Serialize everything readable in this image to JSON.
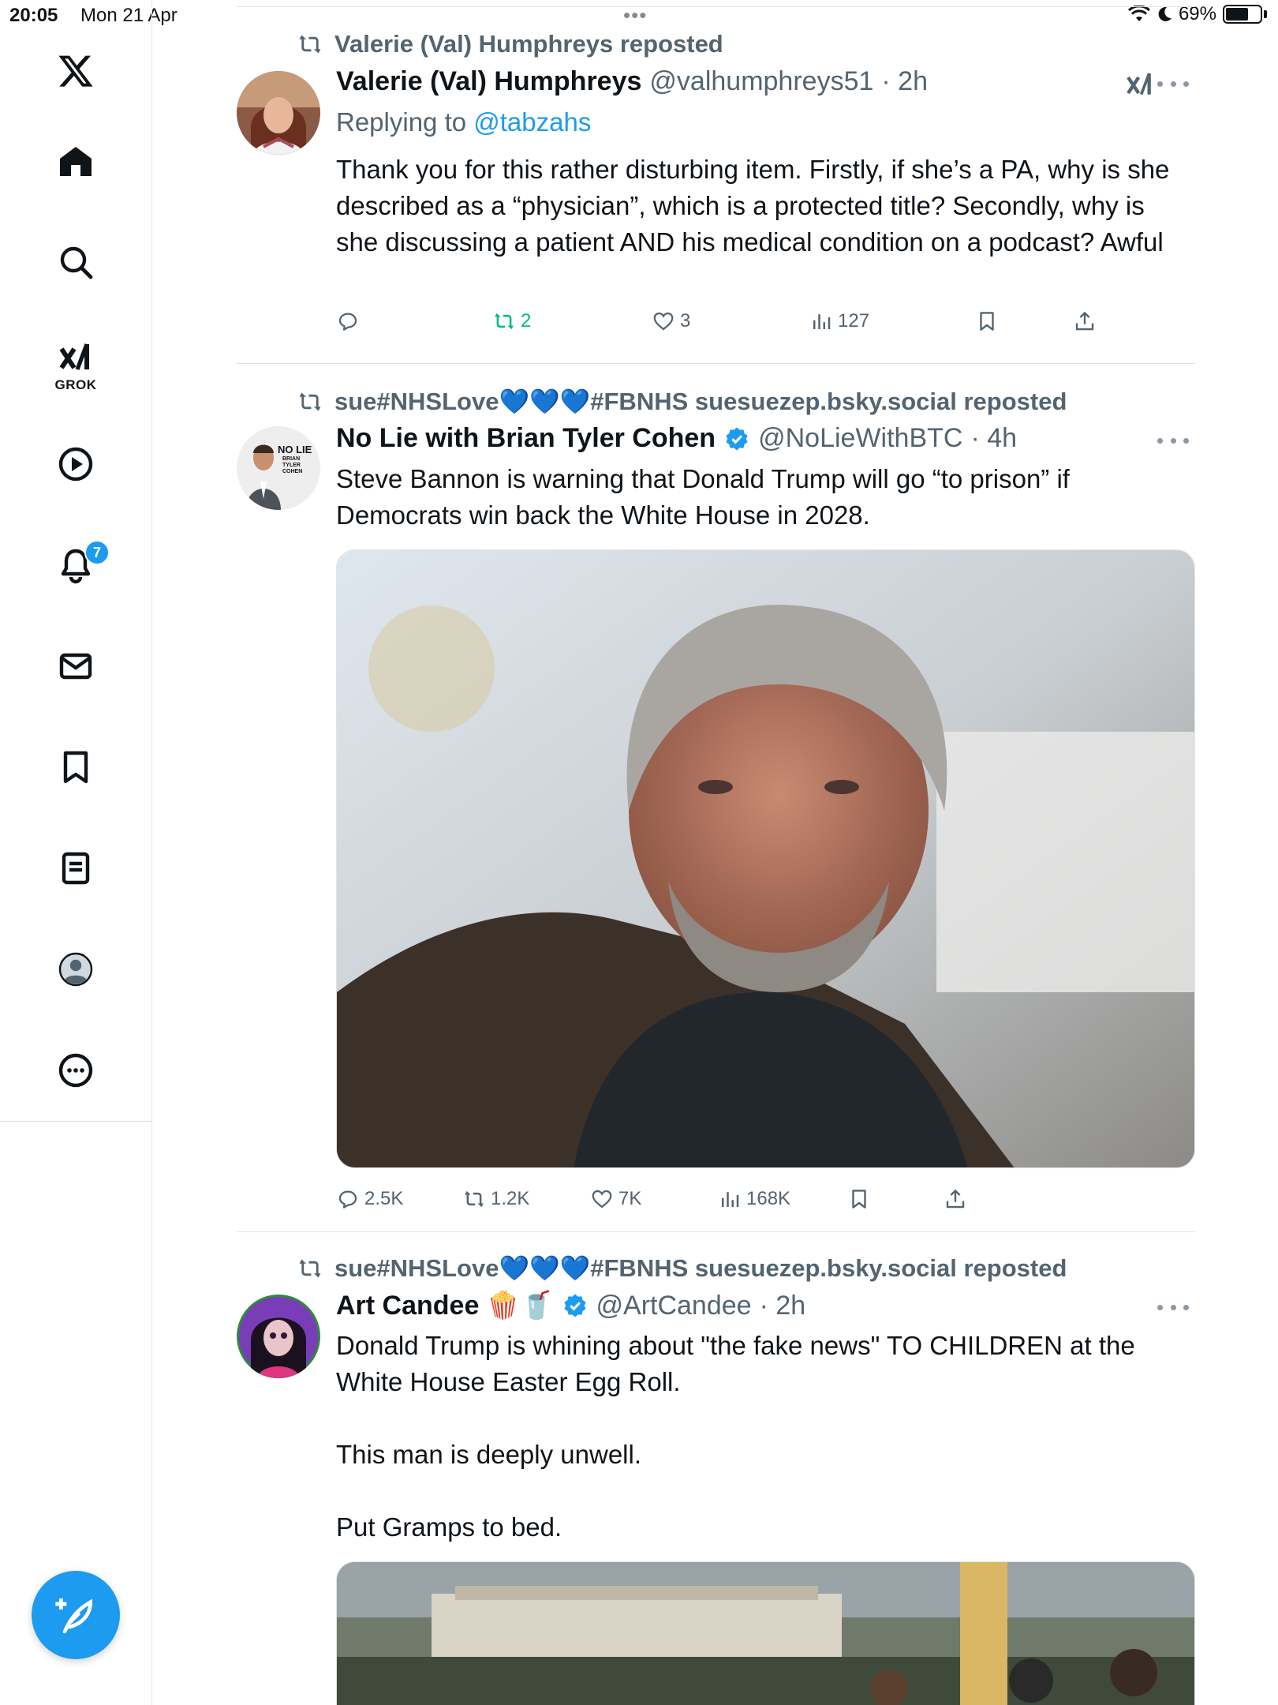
{
  "status_bar": {
    "time": "20:05",
    "date": "Mon 21 Apr",
    "dots": "•••",
    "battery": "69%",
    "battery_level": 0.69
  },
  "sidebar": {
    "items": [
      {
        "name": "logo",
        "icon": "x-logo-icon"
      },
      {
        "name": "home",
        "icon": "home-icon"
      },
      {
        "name": "search",
        "icon": "search-icon"
      },
      {
        "name": "grok",
        "icon": "grok-icon",
        "label": "GROK"
      },
      {
        "name": "video",
        "icon": "play-icon"
      },
      {
        "name": "notifications",
        "icon": "bell-icon",
        "badge": "7"
      },
      {
        "name": "messages",
        "icon": "envelope-icon"
      },
      {
        "name": "bookmarks",
        "icon": "bookmark-icon"
      },
      {
        "name": "lists",
        "icon": "list-icon"
      },
      {
        "name": "profile",
        "icon": "profile-icon"
      },
      {
        "name": "more",
        "icon": "more-circle-icon"
      }
    ],
    "compose_icon": "compose-feather-icon"
  },
  "posts": [
    {
      "reposted_by": "Valerie (Val) Humphreys reposted",
      "display_name": "Valerie (Val) Humphreys",
      "handle": "@valhumphreys51",
      "time": "· 2h",
      "replying_prefix": "Replying to ",
      "replying_to": "@tabzahs",
      "text": "Thank you for this rather disturbing item. Firstly, if she’s a PA, why is she described as a “physician”, which is a protected title? Secondly, why is she discussing a patient AND his medical condition on a podcast? Awful",
      "replies": "",
      "reposts": "2",
      "likes": "3",
      "views": "127"
    },
    {
      "reposted_by": "sue#NHSLove💙💙💙#FBNHS suesuezep.bsky.social reposted",
      "display_name": "No Lie with Brian Tyler Cohen",
      "handle": "@NoLieWithBTC",
      "time": "· 4h",
      "avatar_text_1": "NO LIE",
      "avatar_text_2": "BRIAN TYLER COHEN",
      "text": "Steve Bannon is warning that Donald Trump will go “to prison” if Democrats win back the White House in 2028.",
      "replies": "2.5K",
      "reposts": "1.2K",
      "likes": "7K",
      "views": "168K"
    },
    {
      "reposted_by": "sue#NHSLove💙💙💙#FBNHS suesuezep.bsky.social reposted",
      "display_name": "Art Candee 🍿🥤",
      "handle": "@ArtCandee",
      "time": "· 2h",
      "text": "Donald Trump is whining about \"the fake news\" TO CHILDREN at the White House Easter Egg Roll.\n\nThis man is deeply unwell.\n\nPut Gramps to bed."
    }
  ]
}
